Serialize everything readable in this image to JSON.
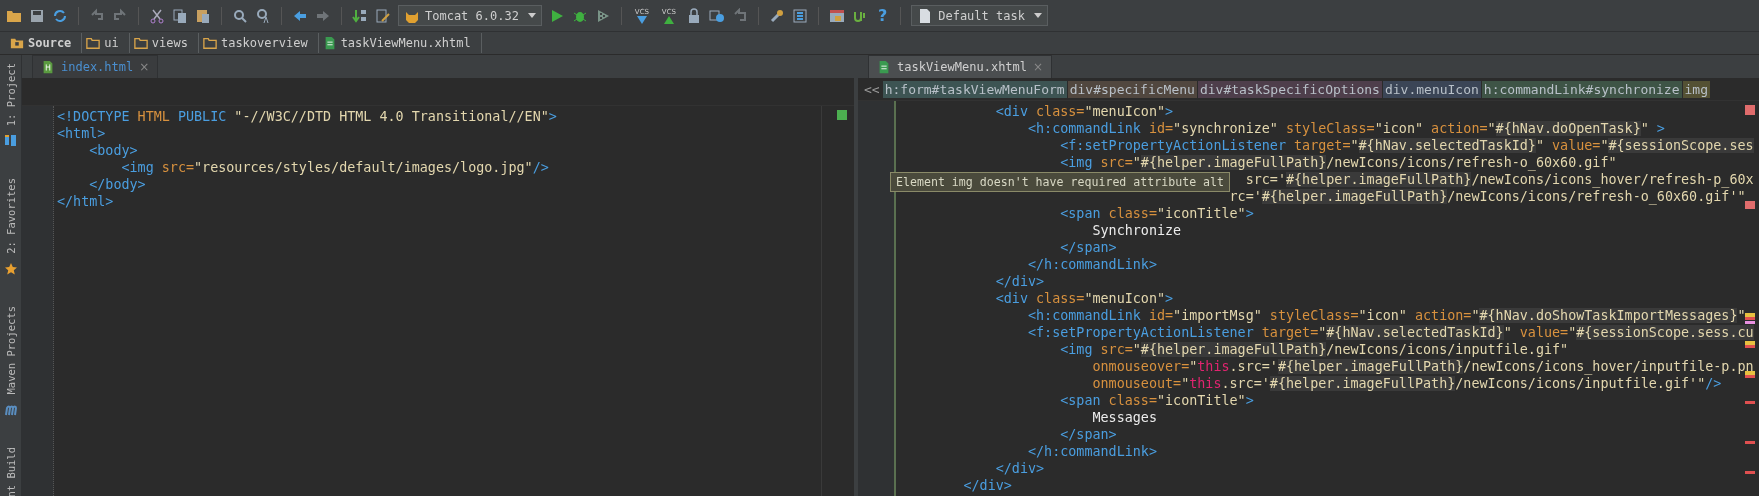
{
  "toolbar": {
    "run_config": "Tomcat 6.0.32",
    "vcs_labels": [
      "VCS",
      "VCS"
    ],
    "help": "?",
    "task": "Default task"
  },
  "breadcrumb": [
    {
      "label": "Source",
      "kind": "source"
    },
    {
      "label": "ui",
      "kind": "folder"
    },
    {
      "label": "views",
      "kind": "folder"
    },
    {
      "label": "taskoverview",
      "kind": "folder"
    },
    {
      "label": "taskViewMenu.xhtml",
      "kind": "file"
    }
  ],
  "tool_windows": [
    {
      "label": "1: Project",
      "kind": "project"
    },
    {
      "label": "2: Favorites",
      "kind": "favorites"
    },
    {
      "label": "Maven Projects",
      "kind": "maven"
    },
    {
      "label": "nt Build",
      "kind": "ant"
    }
  ],
  "editors": [
    {
      "tab": {
        "label": "index.html",
        "selected": false,
        "close": "×"
      },
      "lines": [
        {
          "tokens": [
            {
              "kind": "tag",
              "text": "<!DOCTYPE"
            },
            {
              "kind": "attr",
              "text": " HTML"
            },
            {
              "kind": "tag",
              "text": " PUBLIC"
            },
            {
              "kind": "str",
              "text": " \"-//W3C//DTD HTML 4.0 Transitional//EN\""
            },
            {
              "kind": "tag",
              "text": ">"
            }
          ]
        },
        {
          "tokens": [
            {
              "kind": "tag",
              "text": "<html>"
            }
          ]
        },
        {
          "tokens": [
            {
              "kind": "tag",
              "text": "    <body>"
            }
          ]
        },
        {
          "tokens": [
            {
              "kind": "tag",
              "text": "        <img"
            },
            {
              "kind": "attr",
              "text": " src="
            },
            {
              "kind": "str",
              "text": "\"resources/styles/default/images/logo.jpg\""
            },
            {
              "kind": "tag",
              "text": "/>"
            }
          ]
        },
        {
          "tokens": [
            {
              "kind": "tag",
              "text": "    </body>"
            }
          ]
        },
        {
          "tokens": [
            {
              "kind": "tag",
              "text": "</html>"
            }
          ]
        }
      ]
    },
    {
      "tab": {
        "label": "taskViewMenu.xhtml",
        "selected": true,
        "close": "×"
      },
      "path_back": "<<",
      "path": [
        {
          "label": "h:form#taskViewMenuForm",
          "color": "#3d5453"
        },
        {
          "label": "div#specificMenu",
          "color": "#51473f"
        },
        {
          "label": "div#taskSpecificOptions",
          "color": "#4e3e4b"
        },
        {
          "label": "div.menuIcon",
          "color": "#3b4556"
        },
        {
          "label": "h:commandLink#synchronize",
          "color": "#3e5446"
        },
        {
          "label": "img",
          "color": "#545134"
        }
      ],
      "tooltip": "Element img doesn't have required attribute alt",
      "lines": [
        {
          "tokens": [
            {
              "kind": "tag",
              "text": "            <div"
            },
            {
              "kind": "attr",
              "text": " class="
            },
            {
              "kind": "str",
              "text": "\"menuIcon\""
            },
            {
              "kind": "tag",
              "text": ">"
            }
          ]
        },
        {
          "tokens": [
            {
              "kind": "tag",
              "text": "                <h:commandLink"
            },
            {
              "kind": "attr",
              "text": " id="
            },
            {
              "kind": "str",
              "text": "\"synchronize\""
            },
            {
              "kind": "attr",
              "text": " styleClass="
            },
            {
              "kind": "str",
              "text": "\"icon\""
            },
            {
              "kind": "attr",
              "text": " action="
            },
            {
              "kind": "str",
              "text": "\""
            },
            {
              "kind": "el",
              "text": "#{hNav.doOpenTask}"
            },
            {
              "kind": "str",
              "text": "\""
            },
            {
              "kind": "tag",
              "text": " >"
            }
          ]
        },
        {
          "tokens": [
            {
              "kind": "tag",
              "text": "                    <f:setPropertyActionListener"
            },
            {
              "kind": "attr",
              "text": " target="
            },
            {
              "kind": "str",
              "text": "\""
            },
            {
              "kind": "el",
              "text": "#{hNav.selectedTaskId}"
            },
            {
              "kind": "str",
              "text": "\""
            },
            {
              "kind": "attr",
              "text": " value="
            },
            {
              "kind": "str",
              "text": "\""
            },
            {
              "kind": "el",
              "text": "#{sessionScope.ses"
            }
          ]
        },
        {
          "tokens": [
            {
              "kind": "tag",
              "text": "                    <img"
            },
            {
              "kind": "attr",
              "text": " src="
            },
            {
              "kind": "str",
              "text": "\""
            },
            {
              "kind": "el",
              "text": "#{helper.imageFullPath}"
            },
            {
              "kind": "str",
              "text": "/newIcons/icons/refresh-o_60x60.gif\""
            }
          ]
        },
        {
          "tokens": [
            {
              "kind": "str",
              "text": "                                           src='"
            },
            {
              "kind": "el",
              "text": "#{helper.imageFullPath}"
            },
            {
              "kind": "str",
              "text": "/newIcons/icons_hover/refresh-p_60x"
            }
          ]
        },
        {
          "tokens": [
            {
              "kind": "str",
              "text": "                                         rc='"
            },
            {
              "kind": "el",
              "text": "#{helper.imageFullPath}"
            },
            {
              "kind": "str",
              "text": "/newIcons/icons/refresh-o_60x60.gif'\""
            }
          ]
        },
        {
          "tokens": [
            {
              "kind": "tag",
              "text": "                    <span"
            },
            {
              "kind": "attr",
              "text": " class="
            },
            {
              "kind": "str",
              "text": "\"iconTitle\""
            },
            {
              "kind": "tag",
              "text": ">"
            }
          ]
        },
        {
          "tokens": [
            {
              "kind": "text",
              "text": "                        Synchronize"
            }
          ]
        },
        {
          "tokens": [
            {
              "kind": "tag",
              "text": "                    </span>"
            }
          ]
        },
        {
          "tokens": [
            {
              "kind": "tag",
              "text": "                </h:commandLink>"
            }
          ]
        },
        {
          "tokens": [
            {
              "kind": "tag",
              "text": "            </div>"
            }
          ]
        },
        {
          "tokens": [
            {
              "kind": "tag",
              "text": "            <div"
            },
            {
              "kind": "attr",
              "text": " class="
            },
            {
              "kind": "str",
              "text": "\"menuIcon\""
            },
            {
              "kind": "tag",
              "text": ">"
            }
          ]
        },
        {
          "tokens": [
            {
              "kind": "tag",
              "text": "                <h:commandLink"
            },
            {
              "kind": "attr",
              "text": " id="
            },
            {
              "kind": "str",
              "text": "\"importMsg\""
            },
            {
              "kind": "attr",
              "text": " styleClass="
            },
            {
              "kind": "str",
              "text": "\"icon\""
            },
            {
              "kind": "attr",
              "text": " action="
            },
            {
              "kind": "str",
              "text": "\""
            },
            {
              "kind": "el",
              "text": "#{hNav.doShowTaskImportMessages}"
            },
            {
              "kind": "str",
              "text": "\""
            }
          ]
        },
        {
          "tokens": [
            {
              "kind": "tag",
              "text": "                <f:setPropertyActionListener"
            },
            {
              "kind": "attr",
              "text": " target="
            },
            {
              "kind": "str",
              "text": "\""
            },
            {
              "kind": "el",
              "text": "#{hNav.selectedTaskId}"
            },
            {
              "kind": "str",
              "text": "\""
            },
            {
              "kind": "attr",
              "text": " value="
            },
            {
              "kind": "str",
              "text": "\""
            },
            {
              "kind": "el",
              "text": "#{sessionScope.sess.cu"
            }
          ]
        },
        {
          "tokens": [
            {
              "kind": "tag",
              "text": "                    <img"
            },
            {
              "kind": "attr",
              "text": " src="
            },
            {
              "kind": "str",
              "text": "\""
            },
            {
              "kind": "el",
              "text": "#{helper.imageFullPath}"
            },
            {
              "kind": "str",
              "text": "/newIcons/icons/inputfile.gif\""
            }
          ]
        },
        {
          "tokens": [
            {
              "kind": "attr",
              "text": "                        onmouseover="
            },
            {
              "kind": "str",
              "text": "\""
            },
            {
              "kind": "kw",
              "text": "this"
            },
            {
              "kind": "str",
              "text": ".src='"
            },
            {
              "kind": "el",
              "text": "#{helper.imageFullPath}"
            },
            {
              "kind": "str",
              "text": "/newIcons/icons_hover/inputfile-p.pn"
            }
          ]
        },
        {
          "tokens": [
            {
              "kind": "attr",
              "text": "                        onmouseout="
            },
            {
              "kind": "str",
              "text": "\""
            },
            {
              "kind": "kw",
              "text": "this"
            },
            {
              "kind": "str",
              "text": ".src='"
            },
            {
              "kind": "el",
              "text": "#{helper.imageFullPath}"
            },
            {
              "kind": "str",
              "text": "/newIcons/icons/inputfile.gif'\""
            },
            {
              "kind": "tag",
              "text": "/>"
            }
          ]
        },
        {
          "tokens": [
            {
              "kind": "tag",
              "text": "                    <span"
            },
            {
              "kind": "attr",
              "text": " class="
            },
            {
              "kind": "str",
              "text": "\"iconTitle\""
            },
            {
              "kind": "tag",
              "text": ">"
            }
          ]
        },
        {
          "tokens": [
            {
              "kind": "text",
              "text": "                        Messages"
            }
          ]
        },
        {
          "tokens": [
            {
              "kind": "tag",
              "text": "                    </span>"
            }
          ]
        },
        {
          "tokens": [
            {
              "kind": "tag",
              "text": "                </h:commandLink>"
            }
          ]
        },
        {
          "tokens": [
            {
              "kind": "tag",
              "text": "            </div>"
            }
          ]
        },
        {
          "tokens": [
            {
              "kind": "tag",
              "text": "        </div>"
            }
          ]
        }
      ]
    }
  ]
}
